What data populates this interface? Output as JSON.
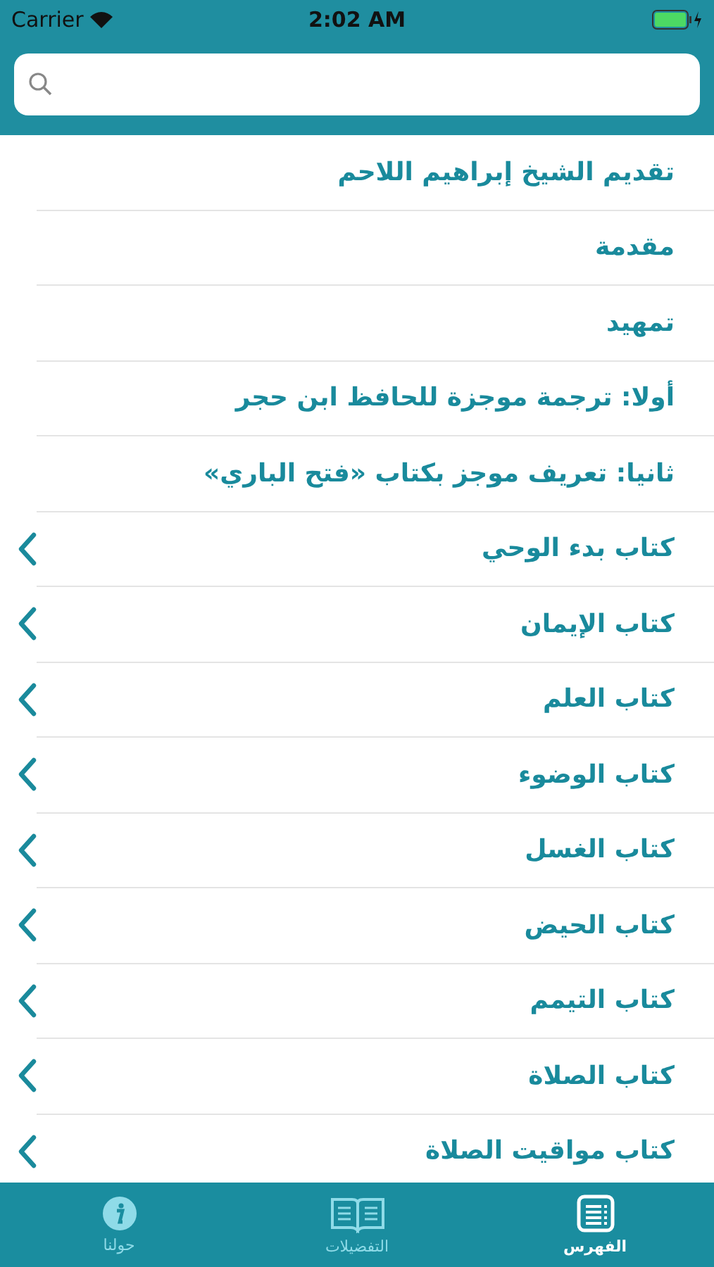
{
  "status_bar": {
    "carrier": "Carrier",
    "time": "2:02 AM"
  },
  "items": [
    {
      "title": "تقديم الشيخ إبراهيم اللاحم",
      "expandable": false
    },
    {
      "title": "مقدمة",
      "expandable": false
    },
    {
      "title": "تمهيد",
      "expandable": false
    },
    {
      "title": "أولا: ترجمة موجزة للحافظ ابن حجر",
      "expandable": false
    },
    {
      "title": "ثانيا: تعريف موجز بكتاب «فتح الباري»",
      "expandable": false
    },
    {
      "title": "كتاب بدء الوحي",
      "expandable": true
    },
    {
      "title": "كتاب الإيمان",
      "expandable": true
    },
    {
      "title": "كتاب العلم",
      "expandable": true
    },
    {
      "title": "كتاب الوضوء",
      "expandable": true
    },
    {
      "title": "كتاب الغسل",
      "expandable": true
    },
    {
      "title": "كتاب الحيض",
      "expandable": true
    },
    {
      "title": "كتاب التيمم",
      "expandable": true
    },
    {
      "title": "كتاب الصلاة",
      "expandable": true
    },
    {
      "title": "كتاب مواقيت الصلاة",
      "expandable": true
    }
  ],
  "tabs": [
    {
      "kind": "index",
      "label": "الفهرس",
      "selected": true
    },
    {
      "kind": "book",
      "label": "التفضيلات",
      "selected": false
    },
    {
      "kind": "info",
      "label": "حولنا",
      "selected": false
    }
  ]
}
